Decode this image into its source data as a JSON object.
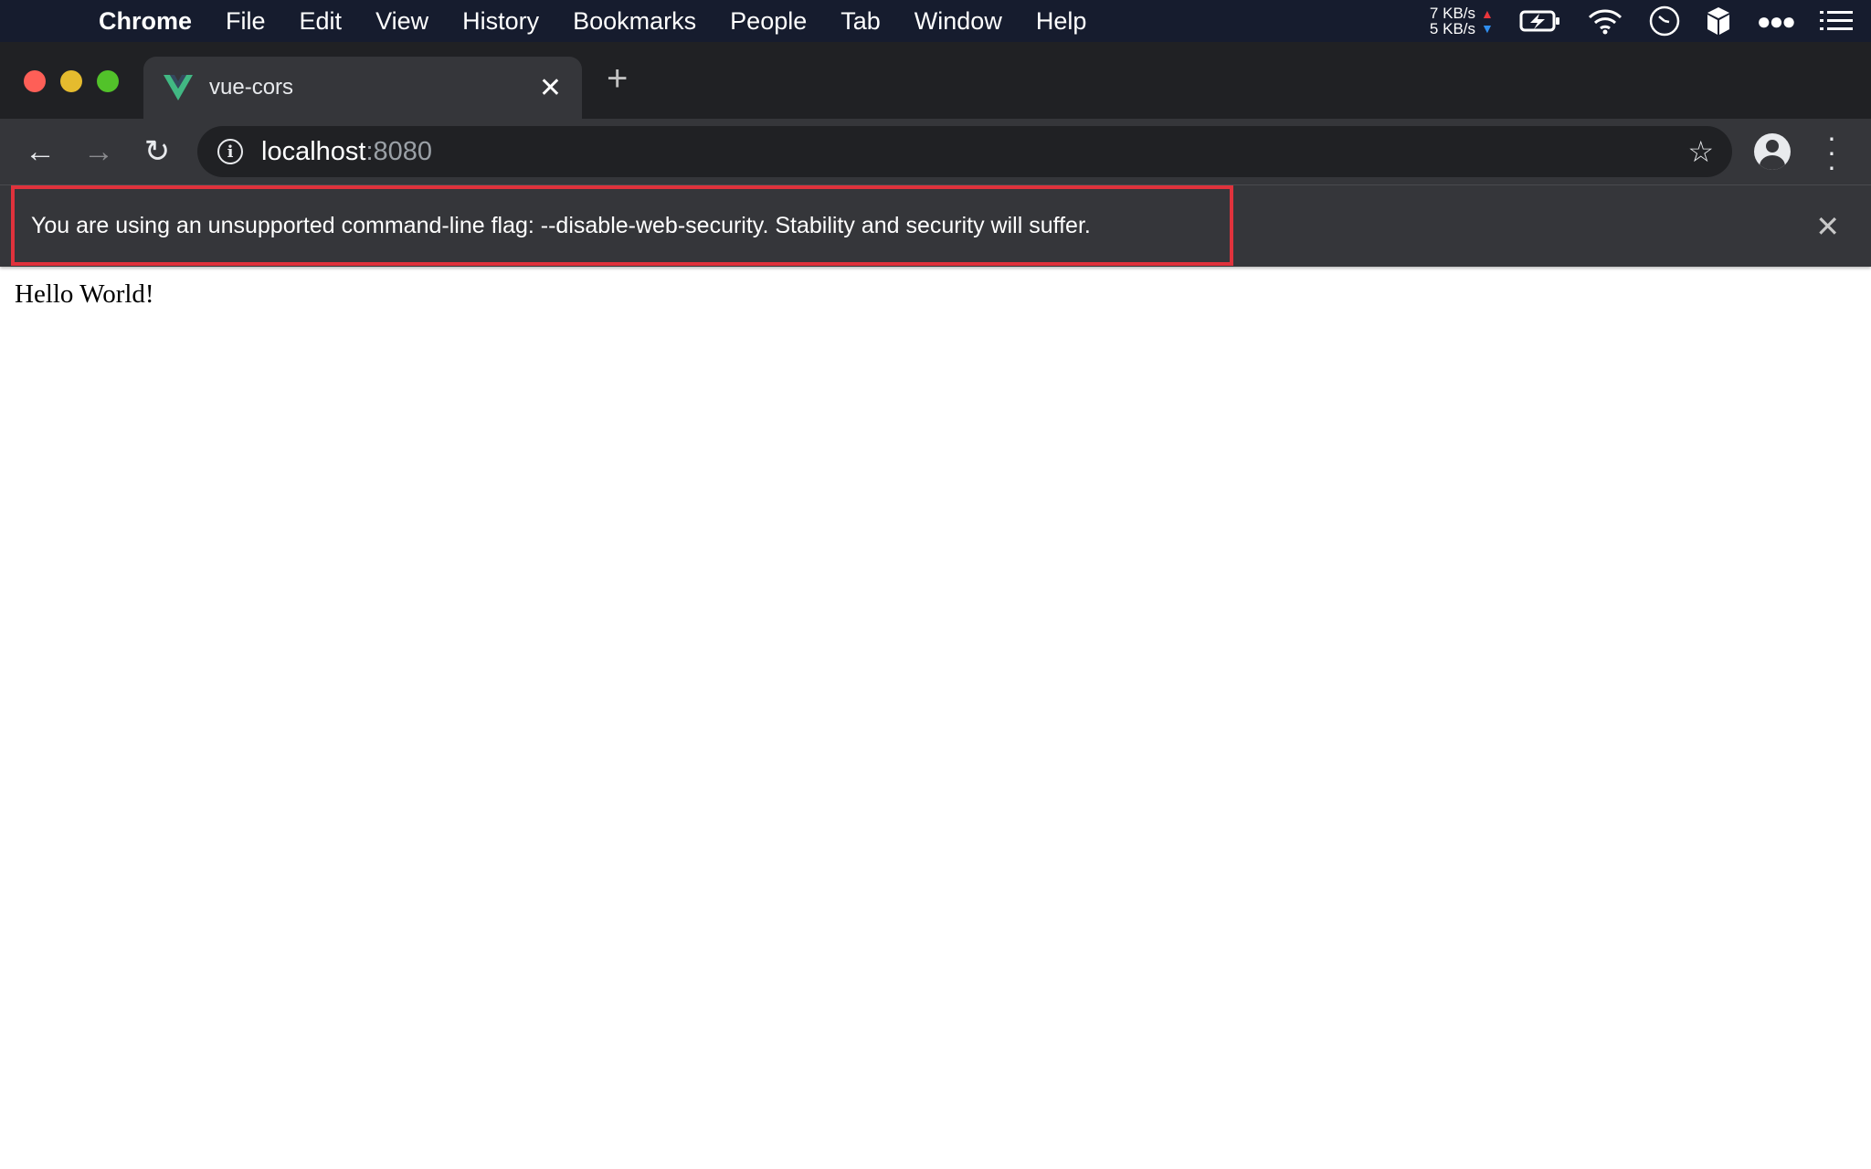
{
  "menubar": {
    "apple_icon": "apple-icon",
    "app": "Chrome",
    "items": [
      "File",
      "Edit",
      "View",
      "History",
      "Bookmarks",
      "People",
      "Tab",
      "Window",
      "Help"
    ],
    "net_up": "7 KB/s",
    "net_down": "5 KB/s",
    "up_color": "#e8363c",
    "down_color": "#2f8ef0"
  },
  "tab": {
    "title": "vue-cors",
    "favicon": "vue-logo-icon",
    "favicon_color": "#41b883"
  },
  "toolbar": {
    "url_host": "localhost",
    "url_port": ":8080"
  },
  "infobar": {
    "message": "You are using an unsupported command-line flag: --disable-web-security. Stability and security will suffer.",
    "highlight_color": "#e0323c"
  },
  "page": {
    "text": "Hello World!"
  }
}
